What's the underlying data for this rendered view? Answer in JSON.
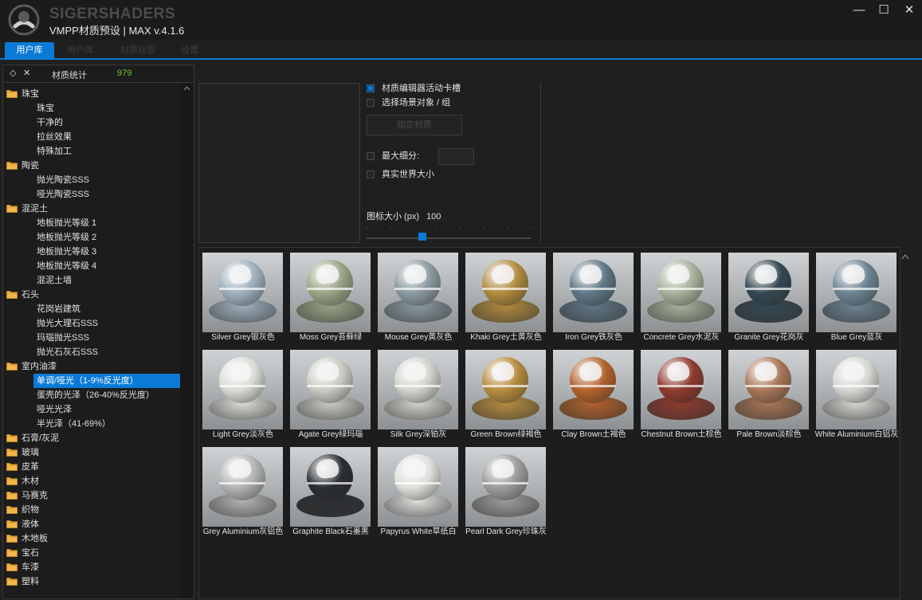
{
  "app": {
    "brand": "SIGERSHADERS",
    "title": "VMPP材质预设 | MAX v.4.1.6"
  },
  "window_buttons": {
    "minimize": "—",
    "maximize": "☐",
    "close": "✕"
  },
  "tabs": [
    "用户库",
    "用户库",
    "材质标签",
    "设置"
  ],
  "stats": {
    "label": "材质统计",
    "count": "979",
    "pin_icon": "◇",
    "close_icon": "✕"
  },
  "tree": [
    {
      "type": "cat",
      "label": "珠宝"
    },
    {
      "type": "sub",
      "label": "珠宝"
    },
    {
      "type": "sub",
      "label": "干净的"
    },
    {
      "type": "sub",
      "label": "拉丝效果"
    },
    {
      "type": "sub",
      "label": "特殊加工"
    },
    {
      "type": "cat",
      "label": "陶瓷"
    },
    {
      "type": "sub",
      "label": "抛光陶瓷SSS"
    },
    {
      "type": "sub",
      "label": "哑光陶瓷SSS"
    },
    {
      "type": "cat",
      "label": "混泥土"
    },
    {
      "type": "sub",
      "label": "地板抛光等级 1"
    },
    {
      "type": "sub",
      "label": "地板抛光等级 2"
    },
    {
      "type": "sub",
      "label": "地板抛光等级 3"
    },
    {
      "type": "sub",
      "label": "地板抛光等级 4"
    },
    {
      "type": "sub",
      "label": "混泥土墙"
    },
    {
      "type": "cat",
      "label": "石头"
    },
    {
      "type": "sub",
      "label": "花岗岩建筑"
    },
    {
      "type": "sub",
      "label": "抛光大理石SSS"
    },
    {
      "type": "sub",
      "label": "玛瑙抛光SSS"
    },
    {
      "type": "sub",
      "label": "抛光石灰石SSS"
    },
    {
      "type": "cat",
      "label": "室内油漆"
    },
    {
      "type": "sel",
      "label": "单调/哑光（1-9%反光度）"
    },
    {
      "type": "sub",
      "label": "蛋壳的光泽（26-40%反光度）"
    },
    {
      "type": "sub",
      "label": "哑光光泽"
    },
    {
      "type": "sub",
      "label": "半光泽（41-69%）"
    },
    {
      "type": "cat",
      "label": "石膏/灰泥"
    },
    {
      "type": "cat",
      "label": "玻璃"
    },
    {
      "type": "cat",
      "label": "皮革"
    },
    {
      "type": "cat",
      "label": "木材"
    },
    {
      "type": "cat",
      "label": "马赛克"
    },
    {
      "type": "cat",
      "label": "织物"
    },
    {
      "type": "cat",
      "label": "液体"
    },
    {
      "type": "cat",
      "label": "木地板"
    },
    {
      "type": "cat",
      "label": "宝石"
    },
    {
      "type": "cat",
      "label": "车漆"
    },
    {
      "type": "cat",
      "label": "塑料"
    }
  ],
  "options": {
    "slot": "材质编辑器活动卡槽",
    "scene": "选择场景对象 / 组",
    "assign": "指定材质",
    "max_subdiv": "最大细分:",
    "real_world": "真实世界大小",
    "icon_size_label": "图标大小 (px)",
    "icon_size_value": "100"
  },
  "slider": {
    "value": 100,
    "fraction": 0.34
  },
  "materials": [
    {
      "name": "Silver Grey银灰色",
      "color": "#9fb0bd"
    },
    {
      "name": "Moss Grey苔藓绿",
      "color": "#9aa486"
    },
    {
      "name": "Mouse Grey黄灰色",
      "color": "#8a9aa0"
    },
    {
      "name": "Khaki Grey土黄灰色",
      "color": "#b08a3e"
    },
    {
      "name": "Iron Grey铁灰色",
      "color": "#5f7786"
    },
    {
      "name": "Concrete Grey水泥灰",
      "color": "#a7b29c"
    },
    {
      "name": "Granite Grey花岗灰",
      "color": "#344852"
    },
    {
      "name": "Blue Grey蓝灰",
      "color": "#6d8392"
    },
    {
      "name": "Light Grey淡灰色",
      "color": "#d9dcd6"
    },
    {
      "name": "Agate Grey绿玛瑙",
      "color": "#c9cbc2"
    },
    {
      "name": "Silk Grey深铂灰",
      "color": "#d2d3cc"
    },
    {
      "name": "Green Brown绿褐色",
      "color": "#b68c3e"
    },
    {
      "name": "Clay Brown土褐色",
      "color": "#b2622c"
    },
    {
      "name": "Chestnut Brown土棕色",
      "color": "#8e3a2e"
    },
    {
      "name": "Pale Brown淡棕色",
      "color": "#a77657"
    },
    {
      "name": "White Aluminium白铝灰",
      "color": "#d5d7d2"
    },
    {
      "name": "Grey Aluminium灰铝色",
      "color": "#b3b5b2"
    },
    {
      "name": "Graphite Black石墨黑",
      "color": "#2b2e31"
    },
    {
      "name": "Papyrus White草纸白",
      "color": "#dfe0dc"
    },
    {
      "name": "Pearl Dark Grey珍珠灰",
      "color": "#9c9d9b"
    }
  ]
}
